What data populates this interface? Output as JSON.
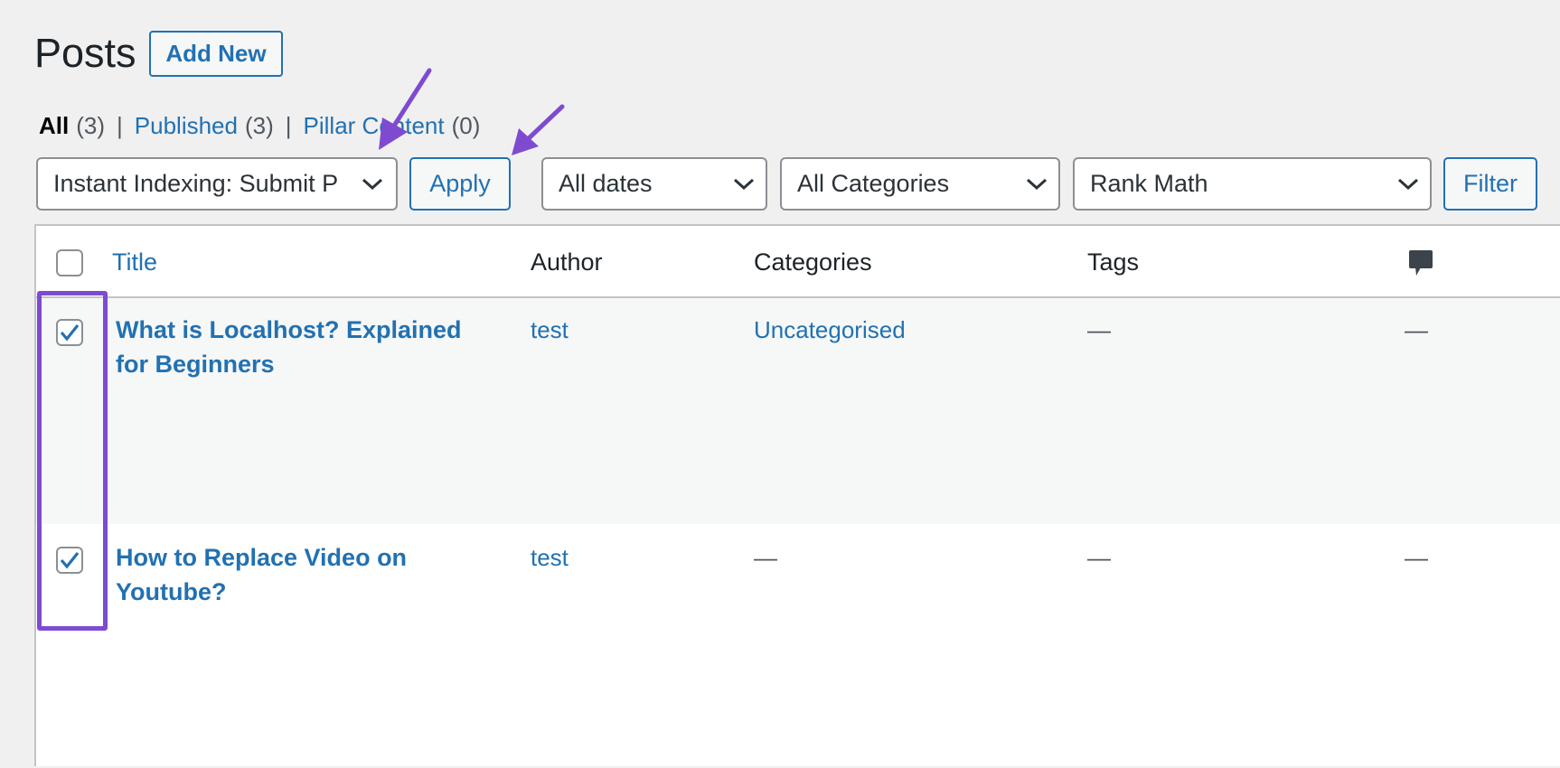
{
  "header": {
    "title": "Posts",
    "add_new_label": "Add New"
  },
  "filters_views": [
    {
      "label": "All",
      "count": "(3)",
      "current": true
    },
    {
      "label": "Published",
      "count": "(3)",
      "current": false
    },
    {
      "label": "Pillar Content",
      "count": "(0)",
      "current": false
    }
  ],
  "toolbar": {
    "bulk_action_value": "Instant Indexing: Submit P",
    "apply_label": "Apply",
    "date_filter_value": "All dates",
    "category_filter_value": "All Categories",
    "seo_filter_value": "Rank Math",
    "filter_label": "Filter"
  },
  "table": {
    "columns": {
      "title": "Title",
      "author": "Author",
      "categories": "Categories",
      "tags": "Tags",
      "comments_icon": "comment-icon"
    },
    "rows": [
      {
        "title_line1": "What is Localhost? Explained",
        "title_line2": "for Beginners",
        "author": "test",
        "categories": "Uncategorised",
        "tags": "—",
        "comments": "—",
        "checked": true
      },
      {
        "title_line1": "How to Replace Video on",
        "title_line2": "Youtube?",
        "author": "test",
        "categories": "—",
        "tags": "—",
        "comments": "—",
        "checked": true
      }
    ]
  },
  "colors": {
    "link": "#2271b1",
    "annotation": "#7e4bd0",
    "background": "#f0f0f1"
  }
}
